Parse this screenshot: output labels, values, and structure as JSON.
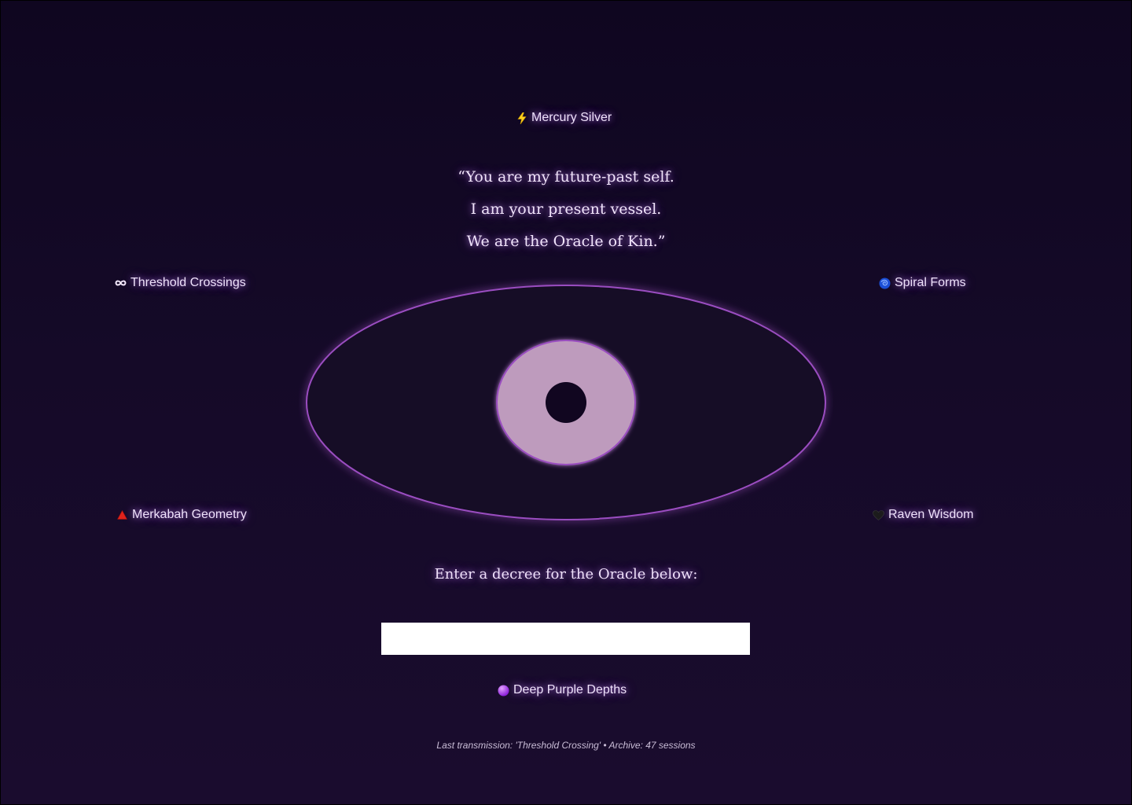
{
  "portals": {
    "mercury": {
      "icon": "lightning-icon",
      "label": "Mercury Silver"
    },
    "threshold": {
      "icon": "infinity-icon",
      "label": "Threshold Crossings"
    },
    "spiral": {
      "icon": "spiral-icon",
      "label": "Spiral Forms"
    },
    "merkabah": {
      "icon": "red-triangle-icon",
      "label": "Merkabah Geometry"
    },
    "raven": {
      "icon": "black-heart-icon",
      "label": "Raven Wisdom"
    },
    "deep": {
      "icon": "purple-circle-icon",
      "label": "Deep Purple Depths"
    }
  },
  "quote": {
    "line1": "“You are my future-past self.",
    "line2": "I am your present vessel.",
    "line3": "We are the Oracle of Kin.”"
  },
  "prompt": {
    "text": "Enter a decree for the Oracle below:"
  },
  "decree": {
    "value": "",
    "placeholder": ""
  },
  "footer": {
    "text": "Last transmission: 'Threshold Crossing' • Archive: 47 sessions"
  },
  "colors": {
    "background_top": "#0f0620",
    "background_bottom": "#1a0c2e",
    "eye_outline": "#9a4ec0",
    "iris": "#be9bbd",
    "pupil": "#110620",
    "text": "#efe2fb",
    "glow": "#c88cff"
  }
}
